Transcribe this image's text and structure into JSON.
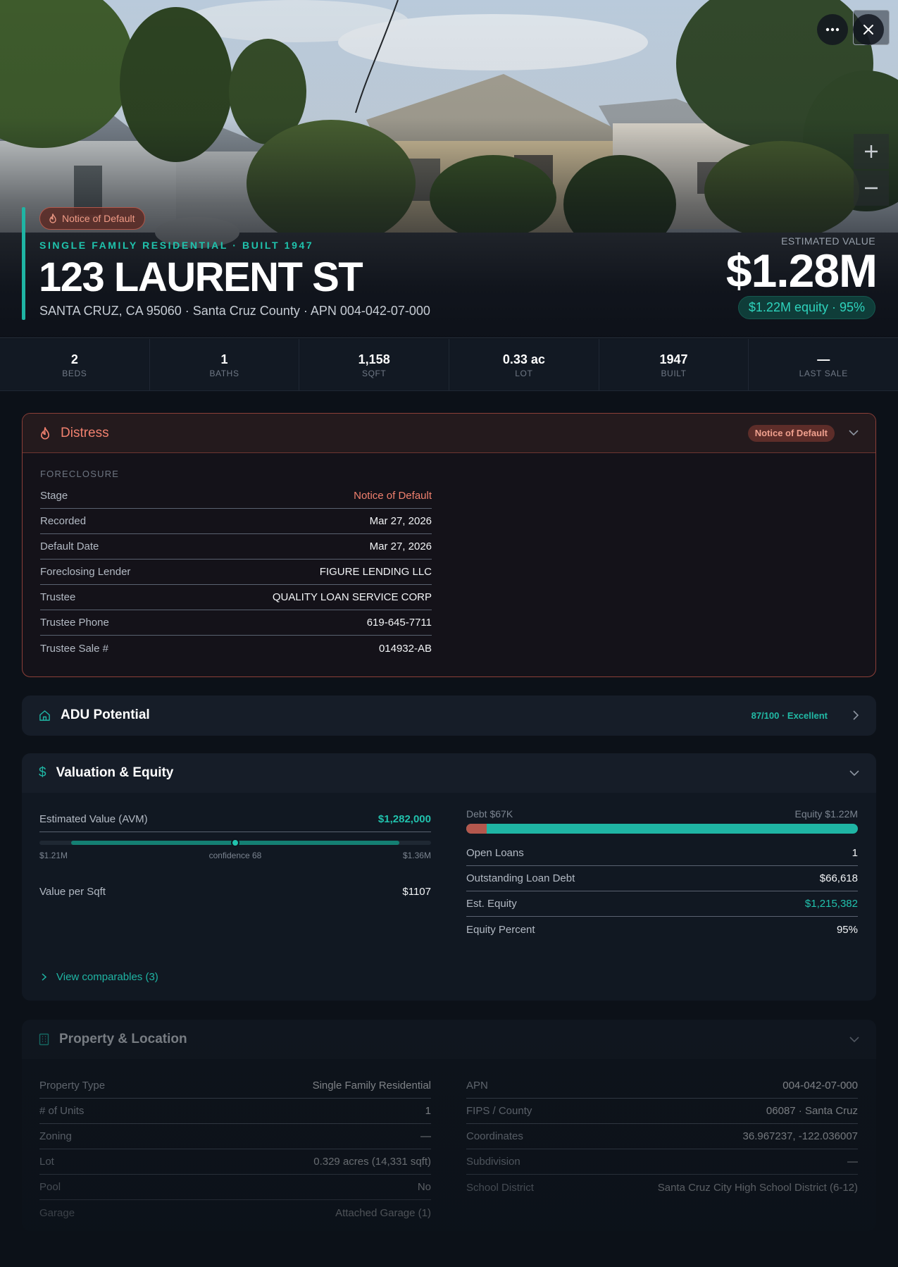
{
  "hero": {
    "badge": "Notice of Default",
    "subtitle": "SINGLE FAMILY RESIDENTIAL · BUILT 1947",
    "title": "123 LAURENT ST",
    "address": "SANTA CRUZ, CA 95060 · Santa Cruz County · APN 004-042-07-000",
    "est_label": "ESTIMATED VALUE",
    "est_value": "$1.28M",
    "equity_pill": "$1.22M equity · 95%"
  },
  "icons": {
    "more": "more-icon",
    "close": "close-icon",
    "zoom_in": "plus-icon",
    "zoom_out": "minus-icon",
    "flame": "flame-icon",
    "home": "home-icon",
    "dollar": "dollar-icon",
    "building": "building-icon",
    "chevron_down": "chevron-down-icon",
    "chevron_right": "chevron-right-icon"
  },
  "stats": [
    {
      "value": "2",
      "label": "BEDS"
    },
    {
      "value": "1",
      "label": "BATHS"
    },
    {
      "value": "1,158",
      "label": "SQFT"
    },
    {
      "value": "0.33 ac",
      "label": "LOT"
    },
    {
      "value": "1947",
      "label": "BUILT"
    },
    {
      "value": "—",
      "label": "LAST SALE"
    }
  ],
  "distress": {
    "title": "Distress",
    "tag": "Notice of Default",
    "section": "FORECLOSURE",
    "rows": [
      {
        "k": "Stage",
        "v": "Notice of Default"
      },
      {
        "k": "Recorded",
        "v": "Mar 27, 2026"
      },
      {
        "k": "Default Date",
        "v": "Mar 27, 2026"
      },
      {
        "k": "Foreclosing Lender",
        "v": "FIGURE LENDING LLC"
      },
      {
        "k": "Trustee",
        "v": "QUALITY LOAN SERVICE CORP"
      },
      {
        "k": "Trustee Phone",
        "v": "619-645-7711"
      },
      {
        "k": "Trustee Sale #",
        "v": "014932-AB"
      }
    ]
  },
  "adu": {
    "title": "ADU Potential",
    "score": "87/100 · Excellent"
  },
  "valuation": {
    "title": "Valuation & Equity",
    "avm_label": "Estimated Value (AVM)",
    "avm_value": "$1,282,000",
    "range_low": "$1.21M",
    "range_high": "$1.36M",
    "confidence": "confidence 68",
    "avm_position": 0.5,
    "value_per_sqft_label": "Value per Sqft",
    "value_per_sqft": "$1107",
    "debt_label": "Debt $67K",
    "equity_label": "Equity $1.22M",
    "debt_fraction": 0.052,
    "rows": [
      {
        "k": "Open Loans",
        "v": "1"
      },
      {
        "k": "Outstanding Loan Debt",
        "v": "$66,618"
      },
      {
        "k": "Est. Equity",
        "v": "$1,215,382"
      },
      {
        "k": "Equity Percent",
        "v": "95%"
      }
    ],
    "comparables": "View comparables (3)"
  },
  "property": {
    "title": "Property & Location",
    "left": [
      {
        "k": "Property Type",
        "v": "Single Family Residential"
      },
      {
        "k": "# of Units",
        "v": "1"
      },
      {
        "k": "Zoning",
        "v": "—"
      },
      {
        "k": "Lot",
        "v": "0.329 acres (14,331 sqft)"
      },
      {
        "k": "Pool",
        "v": "No"
      },
      {
        "k": "Garage",
        "v": "Attached Garage (1)"
      }
    ],
    "right": [
      {
        "k": "APN",
        "v": "004-042-07-000"
      },
      {
        "k": "FIPS / County",
        "v": "06087 · Santa Cruz"
      },
      {
        "k": "Coordinates",
        "v": "36.967237, -122.036007"
      },
      {
        "k": "Subdivision",
        "v": "—"
      },
      {
        "k": "School District",
        "v": "Santa Cruz City High School District (6-12)"
      }
    ]
  },
  "colors": {
    "accent": "#1fb5a4",
    "distress": "#f0806e",
    "debt": "#b4574d",
    "equity": "#1fb5a4"
  }
}
